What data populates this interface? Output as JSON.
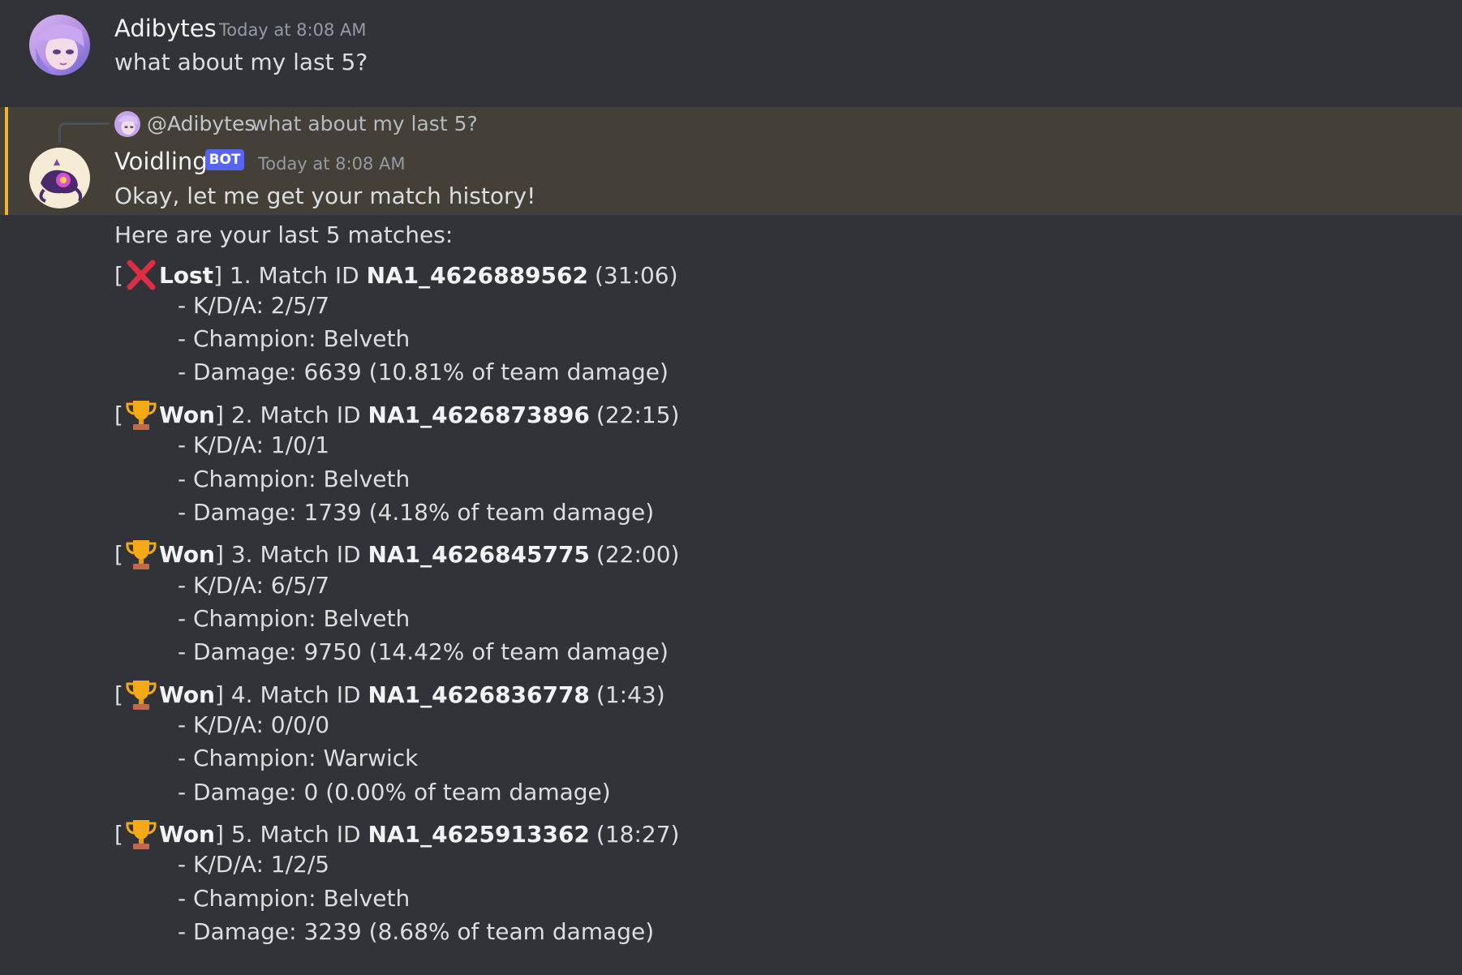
{
  "messages": {
    "first": {
      "username": "Adibytes",
      "timestamp": "Today at 8:08 AM",
      "text": "what about my last 5?"
    },
    "reply": {
      "reference": {
        "mention": "@Adibytes",
        "text": "what about my last 5?"
      },
      "username": "Voidling",
      "bot_tag": "BOT",
      "timestamp": "Today at 8:08 AM",
      "text": "Okay, let me get your match history!"
    },
    "followup": {
      "intro": "Here are your last 5 matches:",
      "matches": [
        {
          "open": "[",
          "icon": "cross-mark-icon",
          "result": "Lost",
          "prefix": "] 1. Match ID ",
          "match_id": "NA1_4626889562",
          "duration": "(31:06)",
          "kda": "- K/D/A: 2/5/7",
          "champion": "- Champion: Belveth",
          "damage": "- Damage: 6639 (10.81% of team damage)"
        },
        {
          "open": "[",
          "icon": "trophy-icon",
          "result": "Won",
          "prefix": "] 2. Match ID ",
          "match_id": "NA1_4626873896",
          "duration": "(22:15)",
          "kda": "- K/D/A: 1/0/1",
          "champion": "- Champion: Belveth",
          "damage": "- Damage: 1739 (4.18% of team damage)"
        },
        {
          "open": "[",
          "icon": "trophy-icon",
          "result": "Won",
          "prefix": "] 3. Match ID ",
          "match_id": "NA1_4626845775",
          "duration": "(22:00)",
          "kda": "- K/D/A: 6/5/7",
          "champion": "- Champion: Belveth",
          "damage": "- Damage: 9750 (14.42% of team damage)"
        },
        {
          "open": "[",
          "icon": "trophy-icon",
          "result": "Won",
          "prefix": "] 4. Match ID ",
          "match_id": "NA1_4626836778",
          "duration": "(1:43)",
          "kda": "- K/D/A: 0/0/0",
          "champion": "- Champion: Warwick",
          "damage": "- Damage: 0 (0.00% of team damage)"
        },
        {
          "open": "[",
          "icon": "trophy-icon",
          "result": "Won",
          "prefix": "] 5. Match ID ",
          "match_id": "NA1_4625913362",
          "duration": "(18:27)",
          "kda": "- K/D/A: 1/2/5",
          "champion": "- Champion: Belveth",
          "damage": "- Damage: 3239 (8.68% of team damage)"
        }
      ]
    }
  },
  "colors": {
    "background": "#313338",
    "highlight": "#444037",
    "highlight_bar": "#f0b232",
    "bot_tag": "#5865f2",
    "lost": "#dd2e44",
    "trophy": "#f4a917"
  }
}
